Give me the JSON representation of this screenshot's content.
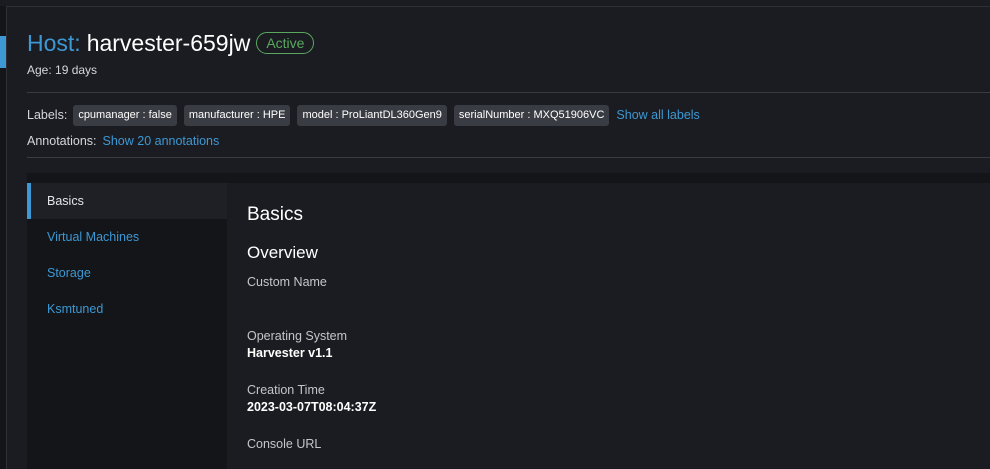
{
  "header": {
    "title_prefix": "Host:",
    "host_name": "harvester-659jw",
    "status": "Active",
    "age_label": "Age:",
    "age_value": "19 days"
  },
  "labels": {
    "caption": "Labels:",
    "items": [
      "cpumanager : false",
      "manufacturer : HPE",
      "model : ProLiantDL360Gen9",
      "serialNumber : MXQ51906VC"
    ],
    "show_all": "Show all labels"
  },
  "annotations": {
    "caption": "Annotations:",
    "show_link": "Show 20 annotations"
  },
  "sidebar": {
    "items": [
      {
        "label": "Basics",
        "active": true
      },
      {
        "label": "Virtual Machines",
        "active": false
      },
      {
        "label": "Storage",
        "active": false
      },
      {
        "label": "Ksmtuned",
        "active": false
      }
    ]
  },
  "main": {
    "section_title": "Basics",
    "overview_title": "Overview",
    "fields": [
      {
        "label": "Custom Name",
        "value": ""
      },
      {
        "label": "Operating System",
        "value": "Harvester v1.1"
      },
      {
        "label": "Creation Time",
        "value": "2023-03-07T08:04:37Z"
      },
      {
        "label": "Console URL",
        "value": ""
      }
    ]
  },
  "colors": {
    "accent": "#3d98d3",
    "status_active": "#5aa85f",
    "background": "#1b1c21"
  }
}
